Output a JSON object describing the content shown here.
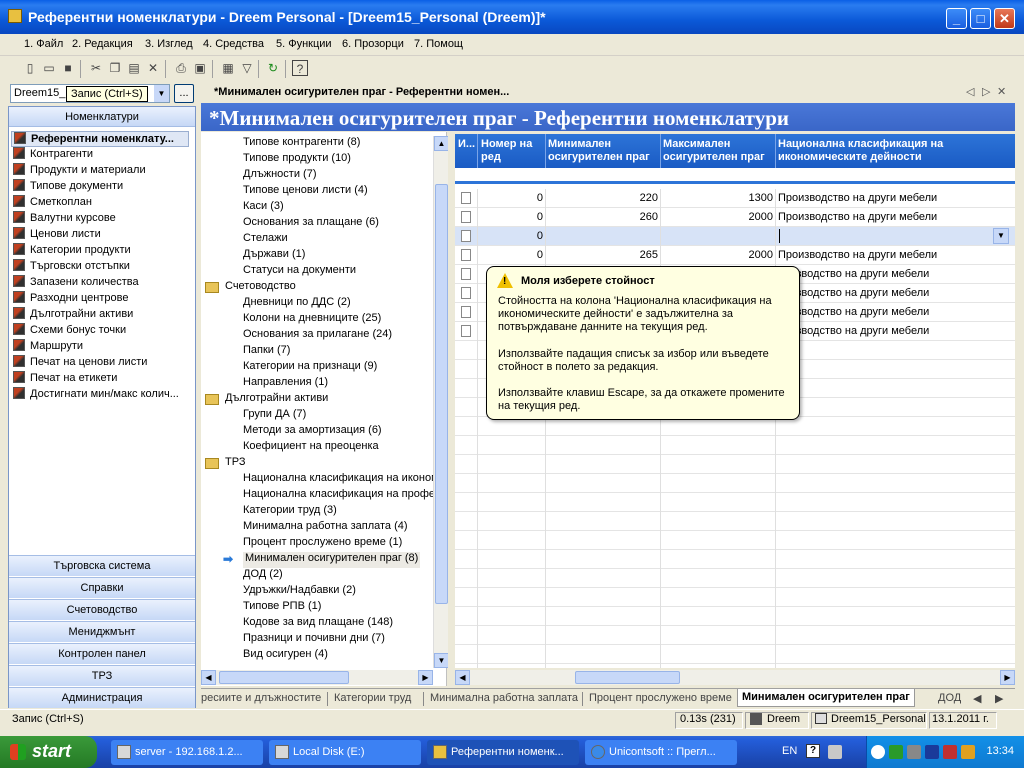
{
  "window": {
    "title": "Референтни номенклатури - Dreem Personal - [Dreem15_Personal (Dreem)]*"
  },
  "menu": [
    "1. Файл",
    "2. Редакция",
    "3. Изглед",
    "4. Средства",
    "5. Функции",
    "6. Прозорци",
    "7. Помощ"
  ],
  "combo": {
    "value": "Dreem15_F",
    "tooltip": "Запис (Ctrl+S)",
    "dots": "..."
  },
  "doc_tab": {
    "label": "*Минимален осигурителен праг - Референтни номен...",
    "nav_prev": "◁",
    "nav_next": "▷",
    "nav_close": "✕"
  },
  "left_panel": {
    "header": "Номенклатури",
    "items": [
      {
        "label": "Референтни номенклату...",
        "selected": true
      },
      {
        "label": "Контрагенти"
      },
      {
        "label": "Продукти и материали"
      },
      {
        "label": "Типове документи"
      },
      {
        "label": "Сметкоплан"
      },
      {
        "label": "Валутни курсове"
      },
      {
        "label": "Ценови листи"
      },
      {
        "label": "Категории продукти"
      },
      {
        "label": "Търговски отстъпки"
      },
      {
        "label": "Запазени количества"
      },
      {
        "label": "Разходни центрове"
      },
      {
        "label": "Дълготрайни активи"
      },
      {
        "label": "Схеми бонус точки"
      },
      {
        "label": "Маршрути"
      },
      {
        "label": "Печат на ценови листи"
      },
      {
        "label": "Печат на етикети"
      },
      {
        "label": "Достигнати мин/макс колич..."
      }
    ],
    "bottom": [
      "Търговска система",
      "Справки",
      "Счетоводство",
      "Мениджмънт",
      "Контролен панел",
      "ТРЗ",
      "Администрация"
    ]
  },
  "banner": {
    "title": "*Минимален осигурителен праг - Референтни номенклатури"
  },
  "tree": {
    "items": [
      {
        "label": "Типове контрагенти",
        "count": "(8)",
        "level": 2
      },
      {
        "label": "Типове продукти",
        "count": "(10)",
        "level": 2
      },
      {
        "label": "Длъжности",
        "count": "(7)",
        "level": 2
      },
      {
        "label": "Типове ценови листи",
        "count": "(4)",
        "level": 2
      },
      {
        "label": "Каси",
        "count": "(3)",
        "level": 2
      },
      {
        "label": "Основания за плащане",
        "count": "(6)",
        "level": 2
      },
      {
        "label": "Стелажи",
        "count": "",
        "level": 2
      },
      {
        "label": "Държави",
        "count": "(1)",
        "level": 2
      },
      {
        "label": "Статуси на документи",
        "count": "",
        "level": 2
      },
      {
        "label": "Счетоводство",
        "count": "",
        "level": 1
      },
      {
        "label": "Дневници по ДДС",
        "count": "(2)",
        "level": 2
      },
      {
        "label": "Колони на дневниците",
        "count": "(25)",
        "level": 2
      },
      {
        "label": "Основания за прилагане",
        "count": "(24)",
        "level": 2
      },
      {
        "label": "Папки",
        "count": "(7)",
        "level": 2
      },
      {
        "label": "Категории на признаци",
        "count": "(9)",
        "level": 2
      },
      {
        "label": "Направления",
        "count": "(1)",
        "level": 2
      },
      {
        "label": "Дълготрайни активи",
        "count": "",
        "level": 1
      },
      {
        "label": "Групи ДА",
        "count": "(7)",
        "level": 2
      },
      {
        "label": "Методи за амортизация",
        "count": "(6)",
        "level": 2
      },
      {
        "label": "Коефициент на преоценка",
        "count": "",
        "level": 2
      },
      {
        "label": "ТРЗ",
        "count": "",
        "level": 1
      },
      {
        "label": "Национална класификация на иконом",
        "count": "",
        "level": 2
      },
      {
        "label": "Национална класификация на профе",
        "count": "",
        "level": 2
      },
      {
        "label": "Категории труд",
        "count": "(3)",
        "level": 2
      },
      {
        "label": "Минимална работна заплата",
        "count": "(4)",
        "level": 2
      },
      {
        "label": "Процент прослужено време",
        "count": "(1)",
        "level": 2
      },
      {
        "label": "Минимален осигурителен праг",
        "count": "(8)",
        "level": 2,
        "current": true
      },
      {
        "label": "ДОД",
        "count": "(2)",
        "level": 2
      },
      {
        "label": "Удръжки/Надбавки",
        "count": "(2)",
        "level": 2
      },
      {
        "label": "Типове РПВ",
        "count": "(1)",
        "level": 2
      },
      {
        "label": "Кодове за вид плащане",
        "count": "(148)",
        "level": 2
      },
      {
        "label": "Празници и почивни дни",
        "count": "(7)",
        "level": 2
      },
      {
        "label": "Вид осигурен",
        "count": "(4)",
        "level": 2
      }
    ]
  },
  "grid": {
    "columns": [
      "И...",
      "Номер на ред",
      "Минимален осигурителен праг",
      "Максимален осигурителен праг",
      "Национална класификация на икономическите дейности"
    ],
    "rows": [
      {
        "n": "0",
        "min": "220",
        "max": "1300",
        "nkid": "Производство на други мебели"
      },
      {
        "n": "0",
        "min": "260",
        "max": "2000",
        "nkid": "Производство на други мебели"
      },
      {
        "n": "0",
        "min": "",
        "max": "",
        "nkid": "",
        "editing": true
      },
      {
        "n": "0",
        "min": "265",
        "max": "2000",
        "nkid": "Производство на други мебели"
      },
      {
        "n": "",
        "min": "",
        "max": "",
        "nkid": "роизводство на други мебели"
      },
      {
        "n": "",
        "min": "",
        "max": "",
        "nkid": "роизводство на други мебели"
      },
      {
        "n": "",
        "min": "",
        "max": "",
        "nkid": "роизводство на други мебели"
      },
      {
        "n": "",
        "min": "",
        "max": "",
        "nkid": "роизводство на други мебели"
      }
    ]
  },
  "callout": {
    "title": "Моля изберете стойност",
    "p1": "Стойността на колона 'Национална класификация на икономическите дейности' е задължителна за потвърждаване данните на текущия ред.",
    "p2": "Използвайте падащия списък за избор или въведете стойност в полето за редакция.",
    "p3": "Използвайте клавиш Escape, за да откажете промените на текущия ред."
  },
  "bottom_tabs": [
    "ресиите и длъжностите",
    "Категории труд",
    "Минимална работна заплата",
    "Процент прослужено време",
    "Минимален осигурителен праг",
    "ДОД"
  ],
  "status": {
    "left": "Запис (Ctrl+S)",
    "time": "0.13s (231)",
    "user": "Dreem",
    "db": "Dreem15_Personal",
    "date": "13.1.2011 г."
  },
  "taskbar": {
    "start": "start",
    "tasks": [
      "server - 192.168.1.2...",
      "Local Disk (E:)",
      "Референтни номенк...",
      "Unicontsoft :: Прегл..."
    ],
    "lang": "EN",
    "clock": "13:34"
  }
}
